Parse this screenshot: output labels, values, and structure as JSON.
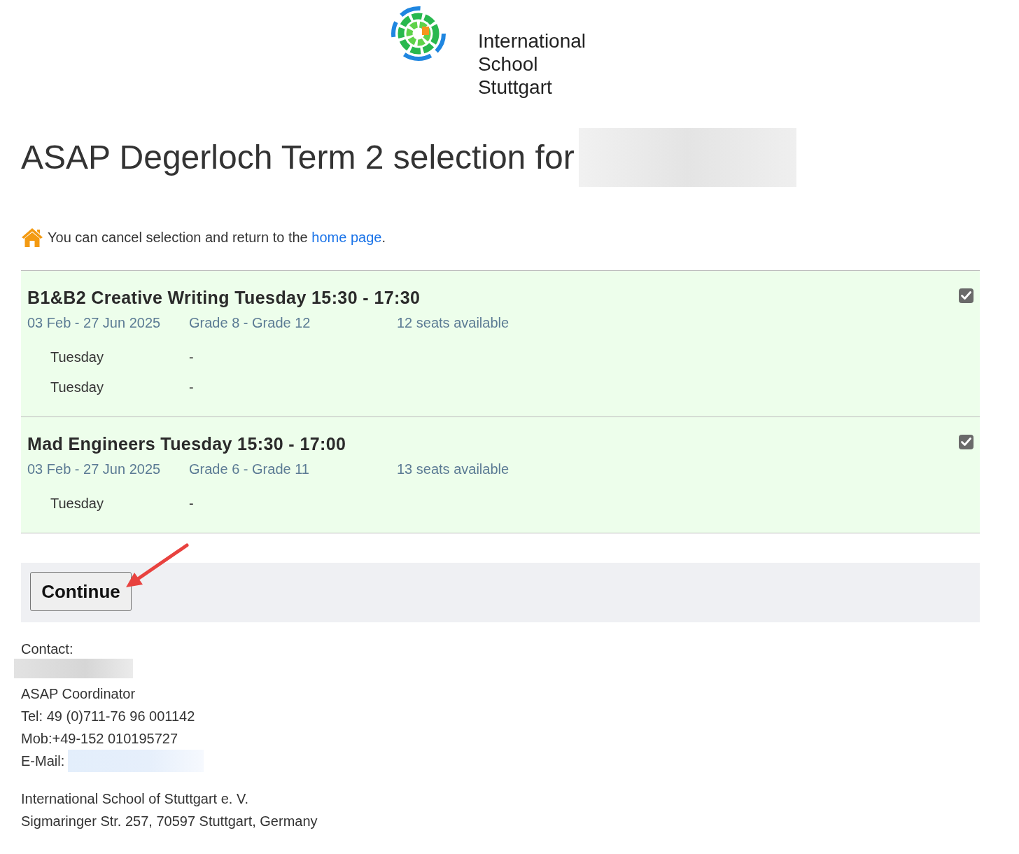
{
  "logo": {
    "name_lines": [
      "International",
      "School",
      "Stuttgart"
    ]
  },
  "heading": {
    "text": "ASAP Degerloch Term 2 selection for",
    "name_hidden": true
  },
  "notice": {
    "text_before": "You can cancel selection and return to the ",
    "link": "home page",
    "text_after": "."
  },
  "activities": [
    {
      "title": "B1&B2 Creative Writing Tuesday 15:30 - 17:30",
      "dates": "03 Feb - 27 Jun 2025",
      "grades": "Grade 8 - Grade 12",
      "seats": "12 seats available",
      "checked": true,
      "sessions": [
        {
          "day": "Tuesday",
          "time": "-"
        },
        {
          "day": "Tuesday",
          "time": "-"
        }
      ]
    },
    {
      "title": "Mad Engineers Tuesday 15:30 - 17:00",
      "dates": "03 Feb - 27 Jun 2025",
      "grades": "Grade 6 - Grade 11",
      "seats": "13 seats available",
      "checked": true,
      "sessions": [
        {
          "day": "Tuesday",
          "time": "-"
        }
      ]
    }
  ],
  "continue_bar": {
    "button": "Continue",
    "pointer_arrow": true
  },
  "contact": {
    "label": "Contact:",
    "name_hidden": true,
    "lines": [
      "ASAP Coordinator",
      "Tel: 49 (0)711-76 96 001142",
      "Mob:+49-152 010195727"
    ],
    "email_label": "E-Mail:",
    "email_hidden": true
  },
  "address": [
    "International School of Stuttgart e. V.",
    "Sigmaringer Str. 257, 70597 Stuttgart, Germany"
  ]
}
